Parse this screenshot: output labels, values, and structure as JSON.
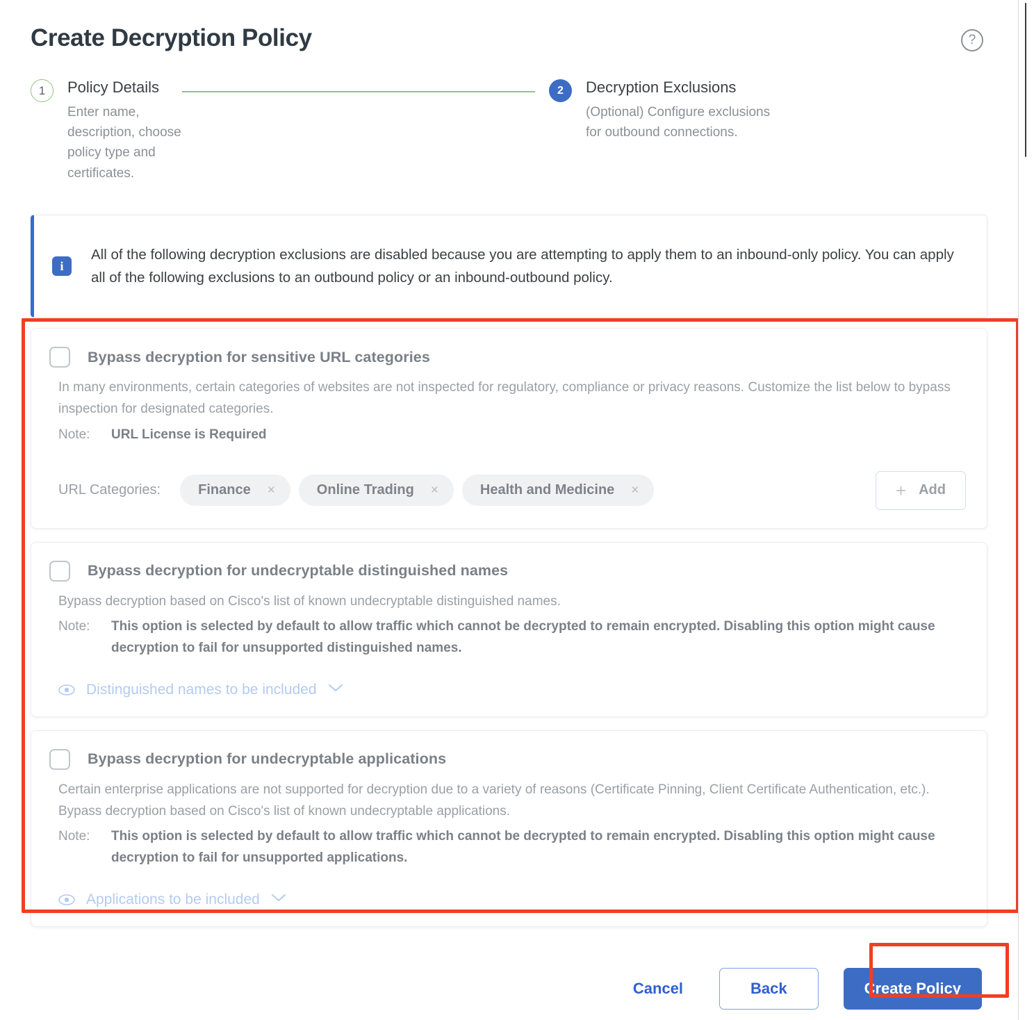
{
  "header": {
    "title": "Create Decryption Policy",
    "help_icon": "help-circle-icon",
    "help_glyph": "?"
  },
  "stepper": {
    "steps": [
      {
        "number": "1",
        "label": "Policy Details",
        "description_line1": "Enter name, description, choose",
        "description_line2": "policy type and certificates.",
        "state": "completed"
      },
      {
        "number": "2",
        "label": "Decryption Exclusions",
        "description_line1": "(Optional) Configure exclusions",
        "description_line2": "for outbound connections.",
        "state": "active"
      }
    ],
    "connector_color": "#93c47d",
    "active_color": "#3d6cc4"
  },
  "info_banner": {
    "icon": "info-icon",
    "icon_glyph": "i",
    "accent_color": "#2f6fd0",
    "message": "All of the following decryption exclusions are disabled because you are attempting to apply them to an inbound-only policy. You can apply all of the following exclusions to an outbound policy or an inbound-outbound policy."
  },
  "sections": [
    {
      "id": "sensitive-url-categories",
      "checkbox_checked": false,
      "title": "Bypass decryption for sensitive URL categories",
      "description": "In many environments, certain categories of websites are not inspected for regulatory, compliance or privacy reasons. Customize the list below to bypass inspection for designated categories.",
      "note_label": "Note:",
      "note_value": "URL License is Required",
      "chips_label": "URL Categories:",
      "chips": [
        {
          "label": "Finance",
          "remove_glyph": "×"
        },
        {
          "label": "Online Trading",
          "remove_glyph": "×"
        },
        {
          "label": "Health and Medicine",
          "remove_glyph": "×"
        }
      ],
      "add_button": {
        "plus_glyph": "+",
        "label": "Add"
      }
    },
    {
      "id": "undecryptable-distinguished-names",
      "checkbox_checked": false,
      "title": "Bypass decryption for undecryptable distinguished names",
      "description": "Bypass decryption based on Cisco's list of known undecryptable distinguished names.",
      "note_label": "Note:",
      "note_value": "This option is selected by default to allow traffic which cannot be decrypted to remain encrypted. Disabling this option might cause decryption to fail for unsupported distinguished names.",
      "expander_label": "Distinguished names to be included",
      "expander_chevron": "⌄"
    },
    {
      "id": "undecryptable-applications",
      "checkbox_checked": false,
      "title": "Bypass decryption for undecryptable applications",
      "description": "Certain enterprise applications are not supported for decryption due to a variety of reasons (Certificate Pinning, Client Certificate Authentication, etc.). Bypass decryption based on Cisco's list of known undecryptable applications.",
      "note_label": "Note:",
      "note_value": "This option is selected by default to allow traffic which cannot be decrypted to remain encrypted. Disabling this option might cause decryption to fail for unsupported applications.",
      "expander_label": "Applications to be included",
      "expander_chevron": "⌄"
    }
  ],
  "footer": {
    "cancel_label": "Cancel",
    "back_label": "Back",
    "create_label": "Create Policy",
    "primary_color": "#3d6cc4"
  },
  "annotations": {
    "highlight_color": "#ef3f24",
    "boxes": [
      "exclusions-sections",
      "create-policy-button"
    ]
  }
}
